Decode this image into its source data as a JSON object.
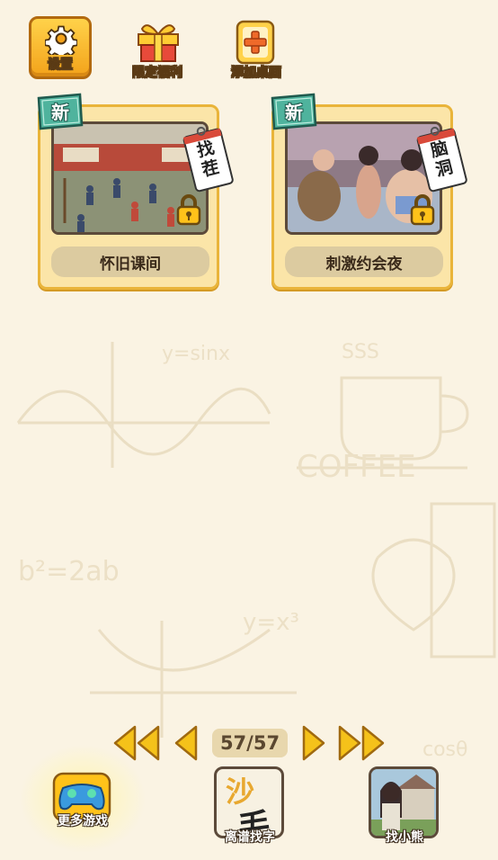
{
  "top_bar": {
    "settings_label": "设置",
    "welfare_label": "限定福利",
    "add_desktop_label": "添加桌面"
  },
  "cards": [
    {
      "title": "怀旧课间",
      "badge": "新",
      "tag": "找茬",
      "locked": true
    },
    {
      "title": "刺激约会夜",
      "badge": "新",
      "tag": "脑洞",
      "locked": true
    }
  ],
  "pager": {
    "page_text": "57/57"
  },
  "bottom": {
    "more_games_label": "更多游戏",
    "find_word_label": "离谱找字",
    "find_word_glyph": "沙",
    "find_word_glyph2": "毛",
    "find_bear_label": "找小熊"
  },
  "colors": {
    "background": "#faf3e3",
    "card_fill": "#fbe5a8",
    "card_border": "#e9b43a",
    "badge_green": "#4fb39d",
    "arrow_yellow": "#f5c21a"
  },
  "icons": [
    "gear-icon",
    "gift-icon",
    "add-icon",
    "lock-icon",
    "first-page-icon",
    "prev-page-icon",
    "next-page-icon",
    "last-page-icon",
    "gamepad-icon"
  ]
}
